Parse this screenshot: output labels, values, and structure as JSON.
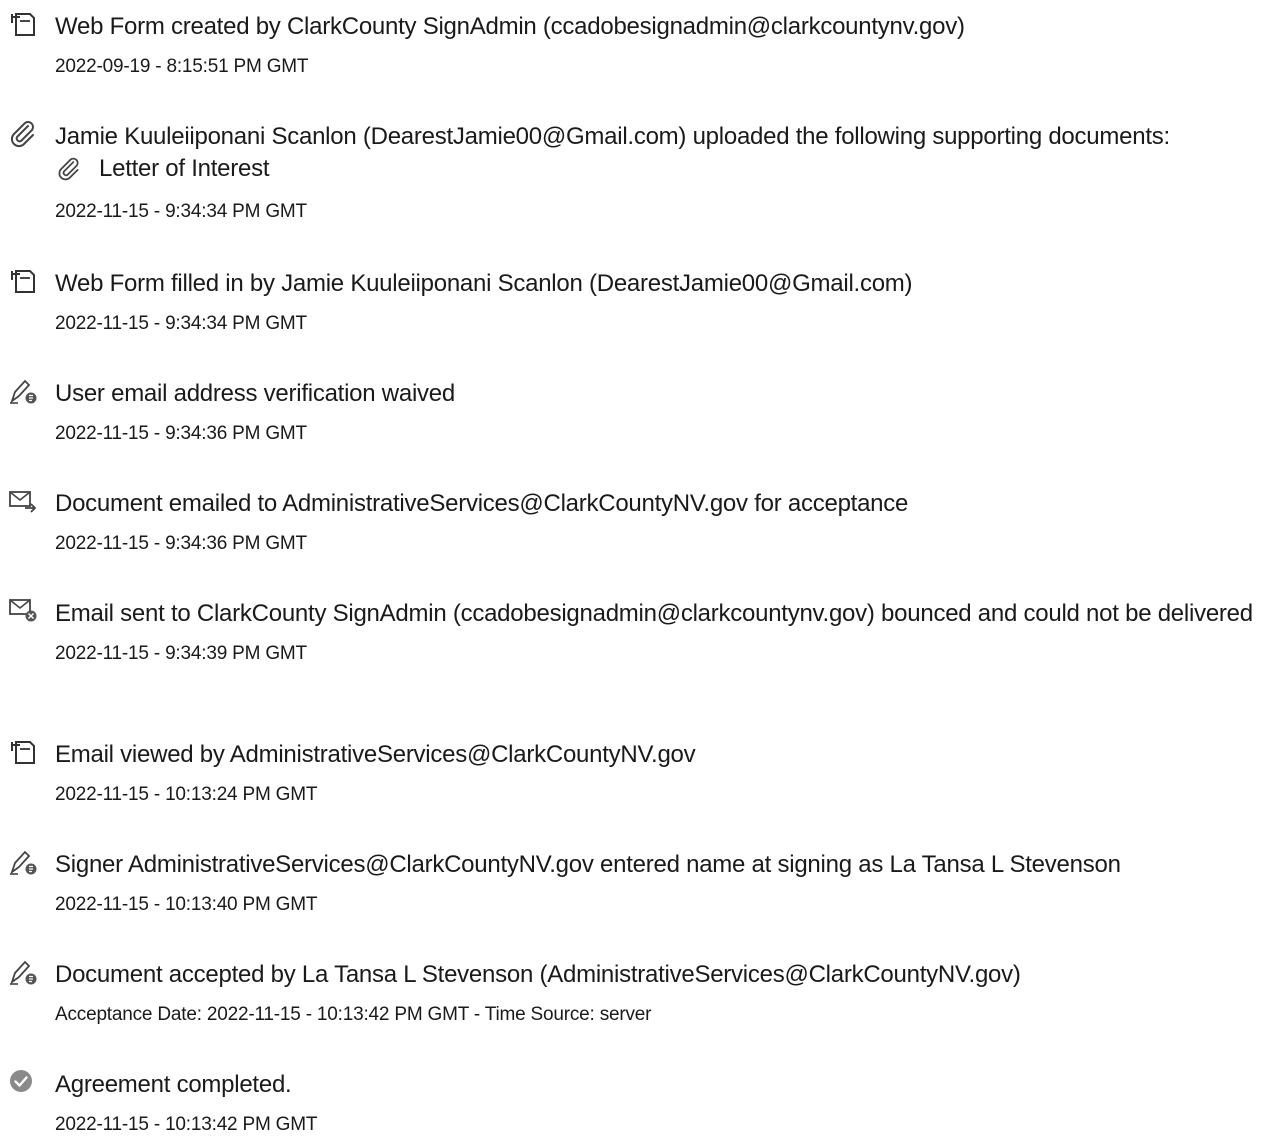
{
  "events": [
    {
      "icon": "web-form-icon",
      "text": "Web Form created by ClarkCounty SignAdmin (ccadobesignadmin@clarkcountynv.gov)",
      "time": "2022-09-19 - 8:15:51 PM GMT"
    },
    {
      "icon": "paperclip-icon",
      "text": "Jamie Kuuleiiponani Scanlon (DearestJamie00@Gmail.com) uploaded the following supporting documents:",
      "attachment": "Letter of Interest",
      "time": "2022-11-15 - 9:34:34 PM GMT"
    },
    {
      "icon": "web-form-icon",
      "text": "Web Form filled in by Jamie Kuuleiiponani Scanlon (DearestJamie00@Gmail.com)",
      "time": "2022-11-15 - 9:34:34 PM GMT"
    },
    {
      "icon": "signer-pen-icon",
      "text": "User email address verification waived",
      "time": "2022-11-15 - 9:34:36 PM GMT"
    },
    {
      "icon": "email-sent-icon",
      "text": "Document emailed to AdministrativeServices@ClarkCountyNV.gov for acceptance",
      "time": "2022-11-15 - 9:34:36 PM GMT"
    },
    {
      "icon": "email-bounced-icon",
      "text": "Email sent to ClarkCounty SignAdmin (ccadobesignadmin@clarkcountynv.gov) bounced and could not be delivered",
      "time": "2022-11-15 - 9:34:39 PM GMT"
    },
    {
      "icon": "web-form-icon",
      "text": "Email viewed by AdministrativeServices@ClarkCountyNV.gov",
      "time": "2022-11-15 - 10:13:24 PM GMT"
    },
    {
      "icon": "signer-pen-icon",
      "text": "Signer AdministrativeServices@ClarkCountyNV.gov entered name at signing as La Tansa L Stevenson",
      "time": "2022-11-15 - 10:13:40 PM GMT"
    },
    {
      "icon": "signer-pen-icon",
      "text": "Document accepted by La Tansa L Stevenson (AdministrativeServices@ClarkCountyNV.gov)",
      "time": "Acceptance Date: 2022-11-15 - 10:13:42 PM GMT - Time Source: server"
    },
    {
      "icon": "check-circle-icon",
      "text": "Agreement completed.",
      "time": "2022-11-15 - 10:13:42 PM GMT"
    }
  ]
}
